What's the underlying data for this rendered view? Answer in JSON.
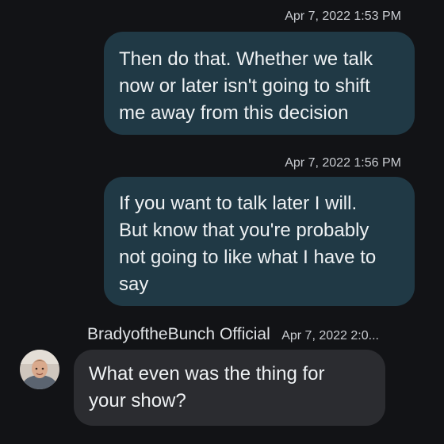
{
  "messages": [
    {
      "timestamp": "Apr 7, 2022 1:53 PM",
      "lines": [
        "Then do that. Whether we talk",
        "now or later isn't going to shift",
        "me away from this decision"
      ]
    },
    {
      "timestamp": "Apr 7, 2022 1:56 PM",
      "lines": [
        "If you want to talk later I will.",
        "But know that you're probably",
        "not going to like what I have to",
        "say"
      ]
    },
    {
      "sender": "BradyoftheBunch Official",
      "timestamp": "Apr 7, 2022 2:0...",
      "lines": [
        "What even was the thing for",
        "your show?"
      ]
    }
  ],
  "colors": {
    "background": "#121316",
    "outgoing_bubble": "#203945",
    "incoming_bubble": "#2b2c30",
    "timestamp_text": "#c9ccd1"
  }
}
